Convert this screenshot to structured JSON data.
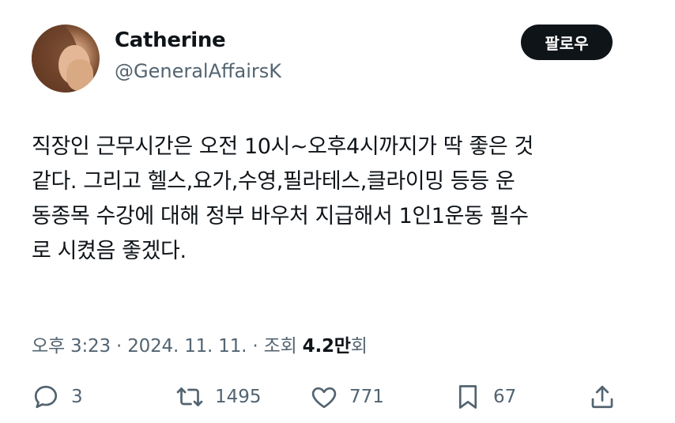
{
  "user": {
    "name": "Catherine",
    "handle": "@GeneralAffairsK"
  },
  "follow_label": "팔로우",
  "tweet": {
    "lines": [
      "직장인 근무시간은 오전 10시~오후4시까지가 딱 좋은 것",
      "같다. 그리고 헬스,요가,수영,필라테스,클라이밍 등등 운",
      "동종목 수강에 대해 정부 바우처 지급해서 1인1운동 필수",
      "로 시켰음 좋겠다."
    ]
  },
  "meta": {
    "time": "오후 3:23",
    "sep1": " · ",
    "date": "2024. 11. 11.",
    "sep2": " · ",
    "views_label": "조회 ",
    "views_count": "4.2만",
    "views_suffix": "회"
  },
  "actions": {
    "reply": {
      "icon": "reply-icon",
      "count": "3"
    },
    "retweet": {
      "icon": "retweet-icon",
      "count": "1495"
    },
    "like": {
      "icon": "heart-icon",
      "count": "771"
    },
    "bookmark": {
      "icon": "bookmark-icon",
      "count": "67"
    },
    "share": {
      "icon": "share-icon"
    }
  },
  "colors": {
    "text": "#0f1419",
    "secondary": "#536471",
    "button_bg": "#0f1419",
    "button_text": "#ffffff"
  }
}
